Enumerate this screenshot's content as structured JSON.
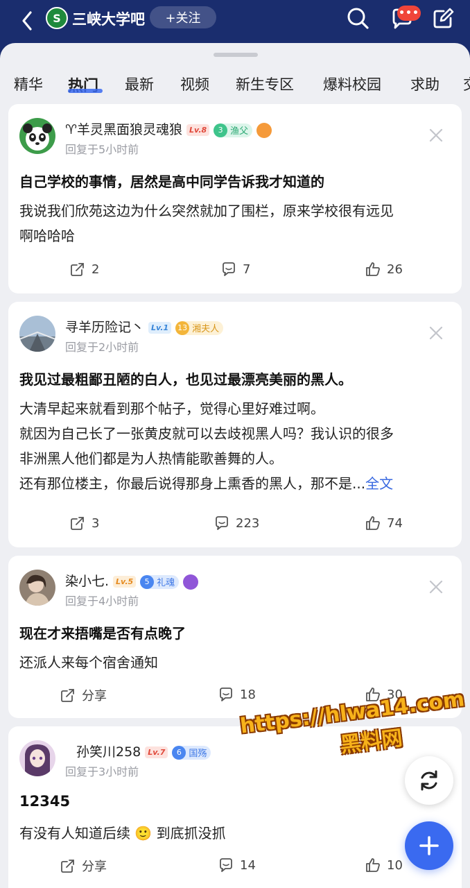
{
  "header": {
    "forum_logo_text": "S",
    "forum_name": "三峡大学吧",
    "follow_label": "+关注",
    "messages_badge": "•••"
  },
  "tabs": [
    "精华",
    "热门",
    "最新",
    "视频",
    "新生专区",
    "爆料校园",
    "求助",
    "交"
  ],
  "active_tab": "热门",
  "posts": [
    {
      "username": "♈羊灵黑面狼灵魂狼",
      "level": "Lv.8",
      "title_num": "3",
      "title_name": "渔父",
      "reply_time": "回复于5小时前",
      "title": "自己学校的事情，居然是高中同学告诉我才知道的",
      "body": [
        "我说我们欣苑这边为什么突然就加了围栏，原来学校很有远见",
        "啊哈哈哈"
      ],
      "share": "2",
      "comments": "7",
      "likes": "26"
    },
    {
      "username": "寻羊历险记丶",
      "level": "Lv.1",
      "title_num": "13",
      "title_name": "湘夫人",
      "reply_time": "回复于2小时前",
      "title": "我见过最粗鄙丑陋的白人，也见过最漂亮美丽的黑人。",
      "body": [
        "大清早起来就看到那个帖子，觉得心里好难过啊。",
        "就因为自己长了一张黄皮就可以去歧视黑人吗？我认识的很多",
        "非洲黑人他们都是为人热情能歌善舞的人。",
        "还有那位楼主，你最后说得那身上熏香的黑人，那不是..."
      ],
      "more": "全文",
      "share": "3",
      "comments": "223",
      "likes": "74"
    },
    {
      "username": "染小七.",
      "level": "Lv.5",
      "title_num": "5",
      "title_name": "礼魂",
      "reply_time": "回复于4小时前",
      "title": "现在才来捂嘴是否有点晚了",
      "body": [
        "还派人来每个宿舍通知"
      ],
      "share": "分享",
      "comments": "18",
      "likes": "30"
    },
    {
      "username": "孙笑川258",
      "level": "Lv.7",
      "title_num": "6",
      "title_name": "国殇",
      "reply_time": "回复于3小时前",
      "title": "12345",
      "body": [
        "有没有人知道后续 🙂 到底抓没抓"
      ],
      "share": "分享",
      "comments": "14",
      "likes": "10"
    }
  ],
  "watermark": {
    "line1": "https://hlwa14.com",
    "line2": "黑料网"
  },
  "colors": {
    "header_bg": "#1a2d6e",
    "accent": "#3a6af0",
    "link": "#3868e0"
  }
}
